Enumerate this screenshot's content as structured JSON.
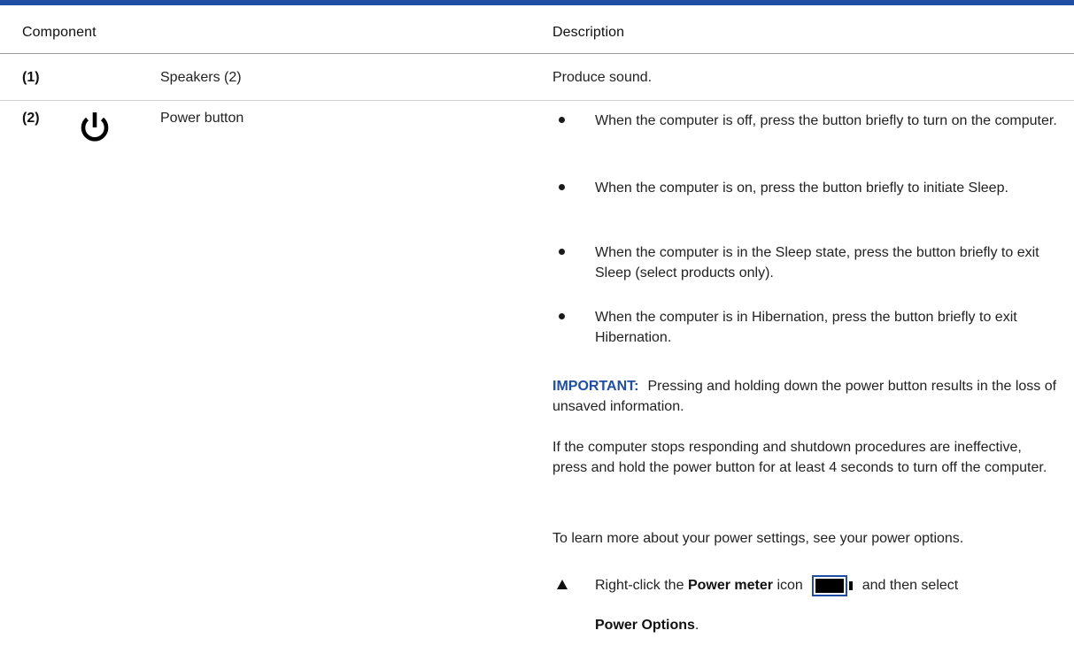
{
  "table": {
    "headers": {
      "component": "Component",
      "description": "Description"
    },
    "rows": [
      {
        "number": "(1)",
        "component": "Speakers (2)",
        "description": "Produce sound."
      },
      {
        "number": "(2)",
        "icon": "power-icon",
        "component": "Power button",
        "bullets": [
          "When the computer is off, press the button briefly to turn on the computer.",
          "When the computer is on, press the button briefly to initiate Sleep.",
          "When the computer is in the Sleep state, press the button briefly to exit Sleep (select products only).",
          "When the computer is in Hibernation, press the button briefly to exit Hibernation."
        ],
        "important_label": "IMPORTANT:",
        "important_text": "Pressing and holding down the power button results in the loss of unsaved information.",
        "paragraph_1": "If the computer stops responding and shutdown procedures are ineffective, press and hold the power button for at least 4 seconds to turn off the computer.",
        "paragraph_2": "To learn more about your power settings, see your power options.",
        "step": {
          "prefix": "Right-click the",
          "bold_1": "Power meter",
          "middle": "icon",
          "icon": "battery-icon",
          "suffix": "and then select",
          "bold_2": "Power Options",
          "end": "."
        }
      }
    ]
  },
  "colors": {
    "accent": "#1f4ea3",
    "text": "#222222"
  }
}
